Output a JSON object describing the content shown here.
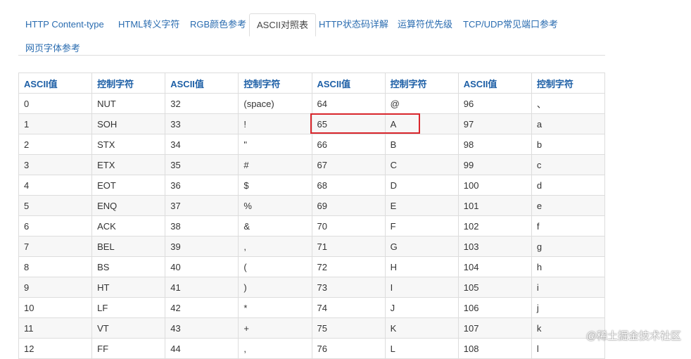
{
  "tabs": [
    {
      "label": "HTTP Content-type",
      "active": false
    },
    {
      "label": "HTML转义字符",
      "active": false
    },
    {
      "label": "RGB颜色参考",
      "active": false
    },
    {
      "label": "ASCII对照表",
      "active": true
    },
    {
      "label": "HTTP状态码详解",
      "active": false
    },
    {
      "label": "运算符优先级",
      "active": false
    },
    {
      "label": "TCP/UDP常见端口参考",
      "active": false
    },
    {
      "label": "网页字体参考",
      "active": false
    }
  ],
  "table": {
    "headers": [
      "ASCII值",
      "控制字符",
      "ASCII值",
      "控制字符",
      "ASCII值",
      "控制字符",
      "ASCII值",
      "控制字符"
    ],
    "rows": [
      [
        "0",
        "NUT",
        "32",
        "(space)",
        "64",
        "@",
        "96",
        "、"
      ],
      [
        "1",
        "SOH",
        "33",
        "!",
        "65",
        "A",
        "97",
        "a"
      ],
      [
        "2",
        "STX",
        "34",
        "\"",
        "66",
        "B",
        "98",
        "b"
      ],
      [
        "3",
        "ETX",
        "35",
        "#",
        "67",
        "C",
        "99",
        "c"
      ],
      [
        "4",
        "EOT",
        "36",
        "$",
        "68",
        "D",
        "100",
        "d"
      ],
      [
        "5",
        "ENQ",
        "37",
        "%",
        "69",
        "E",
        "101",
        "e"
      ],
      [
        "6",
        "ACK",
        "38",
        "&",
        "70",
        "F",
        "102",
        "f"
      ],
      [
        "7",
        "BEL",
        "39",
        ",",
        "71",
        "G",
        "103",
        "g"
      ],
      [
        "8",
        "BS",
        "40",
        "(",
        "72",
        "H",
        "104",
        "h"
      ],
      [
        "9",
        "HT",
        "41",
        ")",
        "73",
        "I",
        "105",
        "i"
      ],
      [
        "10",
        "LF",
        "42",
        "*",
        "74",
        "J",
        "106",
        "j"
      ],
      [
        "11",
        "VT",
        "43",
        "+",
        "75",
        "K",
        "107",
        "k"
      ],
      [
        "12",
        "FF",
        "44",
        ",",
        "76",
        "L",
        "108",
        "l"
      ]
    ]
  },
  "watermark": "@稀土掘金技术社区"
}
